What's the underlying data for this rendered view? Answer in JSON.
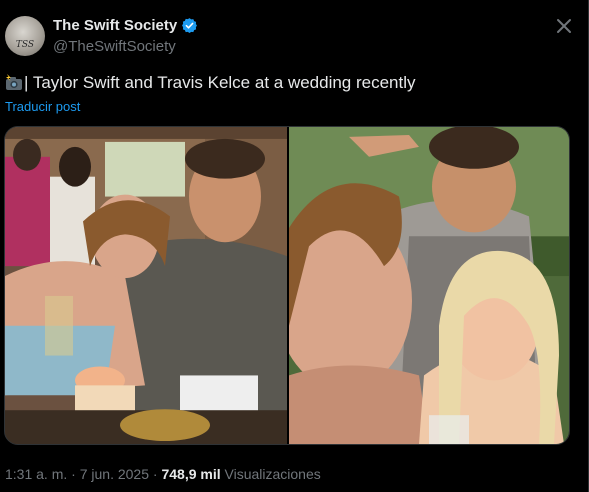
{
  "tweet": {
    "author_name": "The Swift Society",
    "author_handle": "@TheSwiftSociety",
    "avatar_text": "TSS",
    "text": "| Taylor Swift and Travis Kelce at a wedding recently",
    "translate_label": "Traducir post",
    "time": "1:31 a. m.",
    "separator": "·",
    "date": "7 jun. 2025",
    "views_count": "748,9 mil",
    "views_label": "Visualizaciones"
  },
  "icons": {
    "verified": "verified-badge-icon",
    "camera": "camera-with-flash-icon",
    "close": "close-icon"
  },
  "colors": {
    "background": "#000000",
    "text": "#e7e9ea",
    "muted": "#71767b",
    "link": "#1d9bf0",
    "verified": "#1d9bf0"
  }
}
